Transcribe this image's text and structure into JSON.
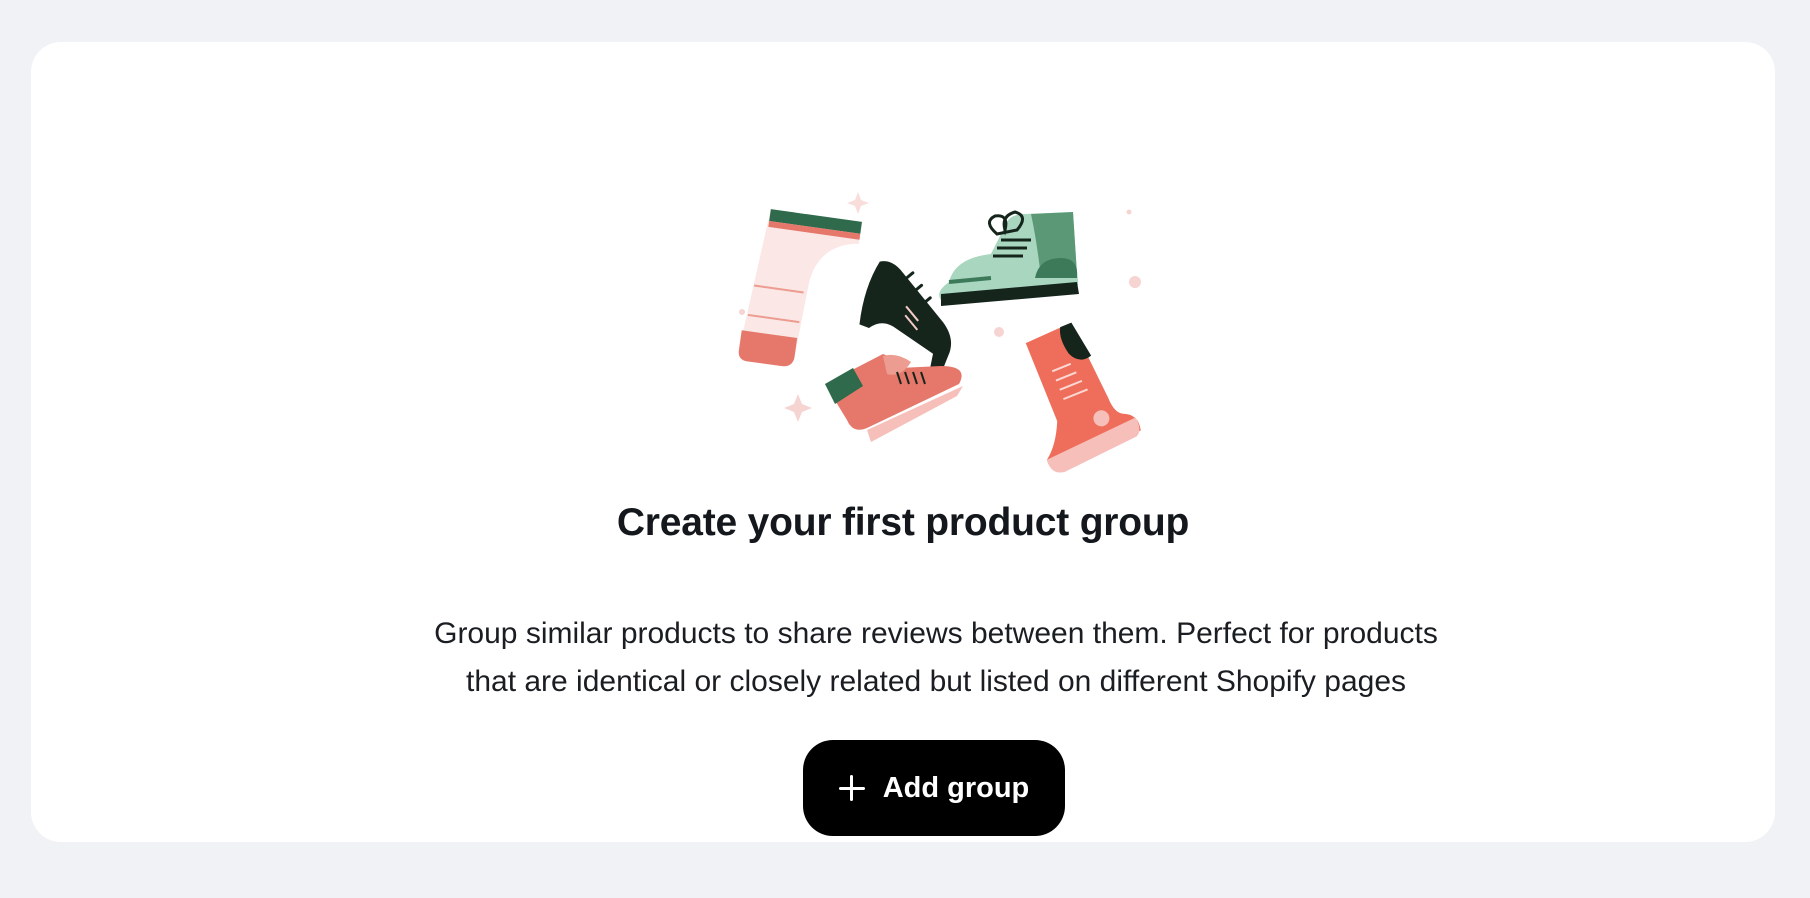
{
  "empty_state": {
    "title": "Create your first product group",
    "description_line1": "Group similar products to share reviews between them. Perfect for products",
    "description_line2": "that are identical or closely related but listed on different Shopify pages",
    "illustration_icon": "shoes-illustration"
  },
  "actions": {
    "add_group_label": "Add group",
    "add_group_icon": "plus-icon"
  },
  "colors": {
    "page_background": "#f1f2f6",
    "card_background": "#ffffff",
    "button_background": "#000000",
    "button_text": "#ffffff",
    "title_text": "#14171c"
  }
}
